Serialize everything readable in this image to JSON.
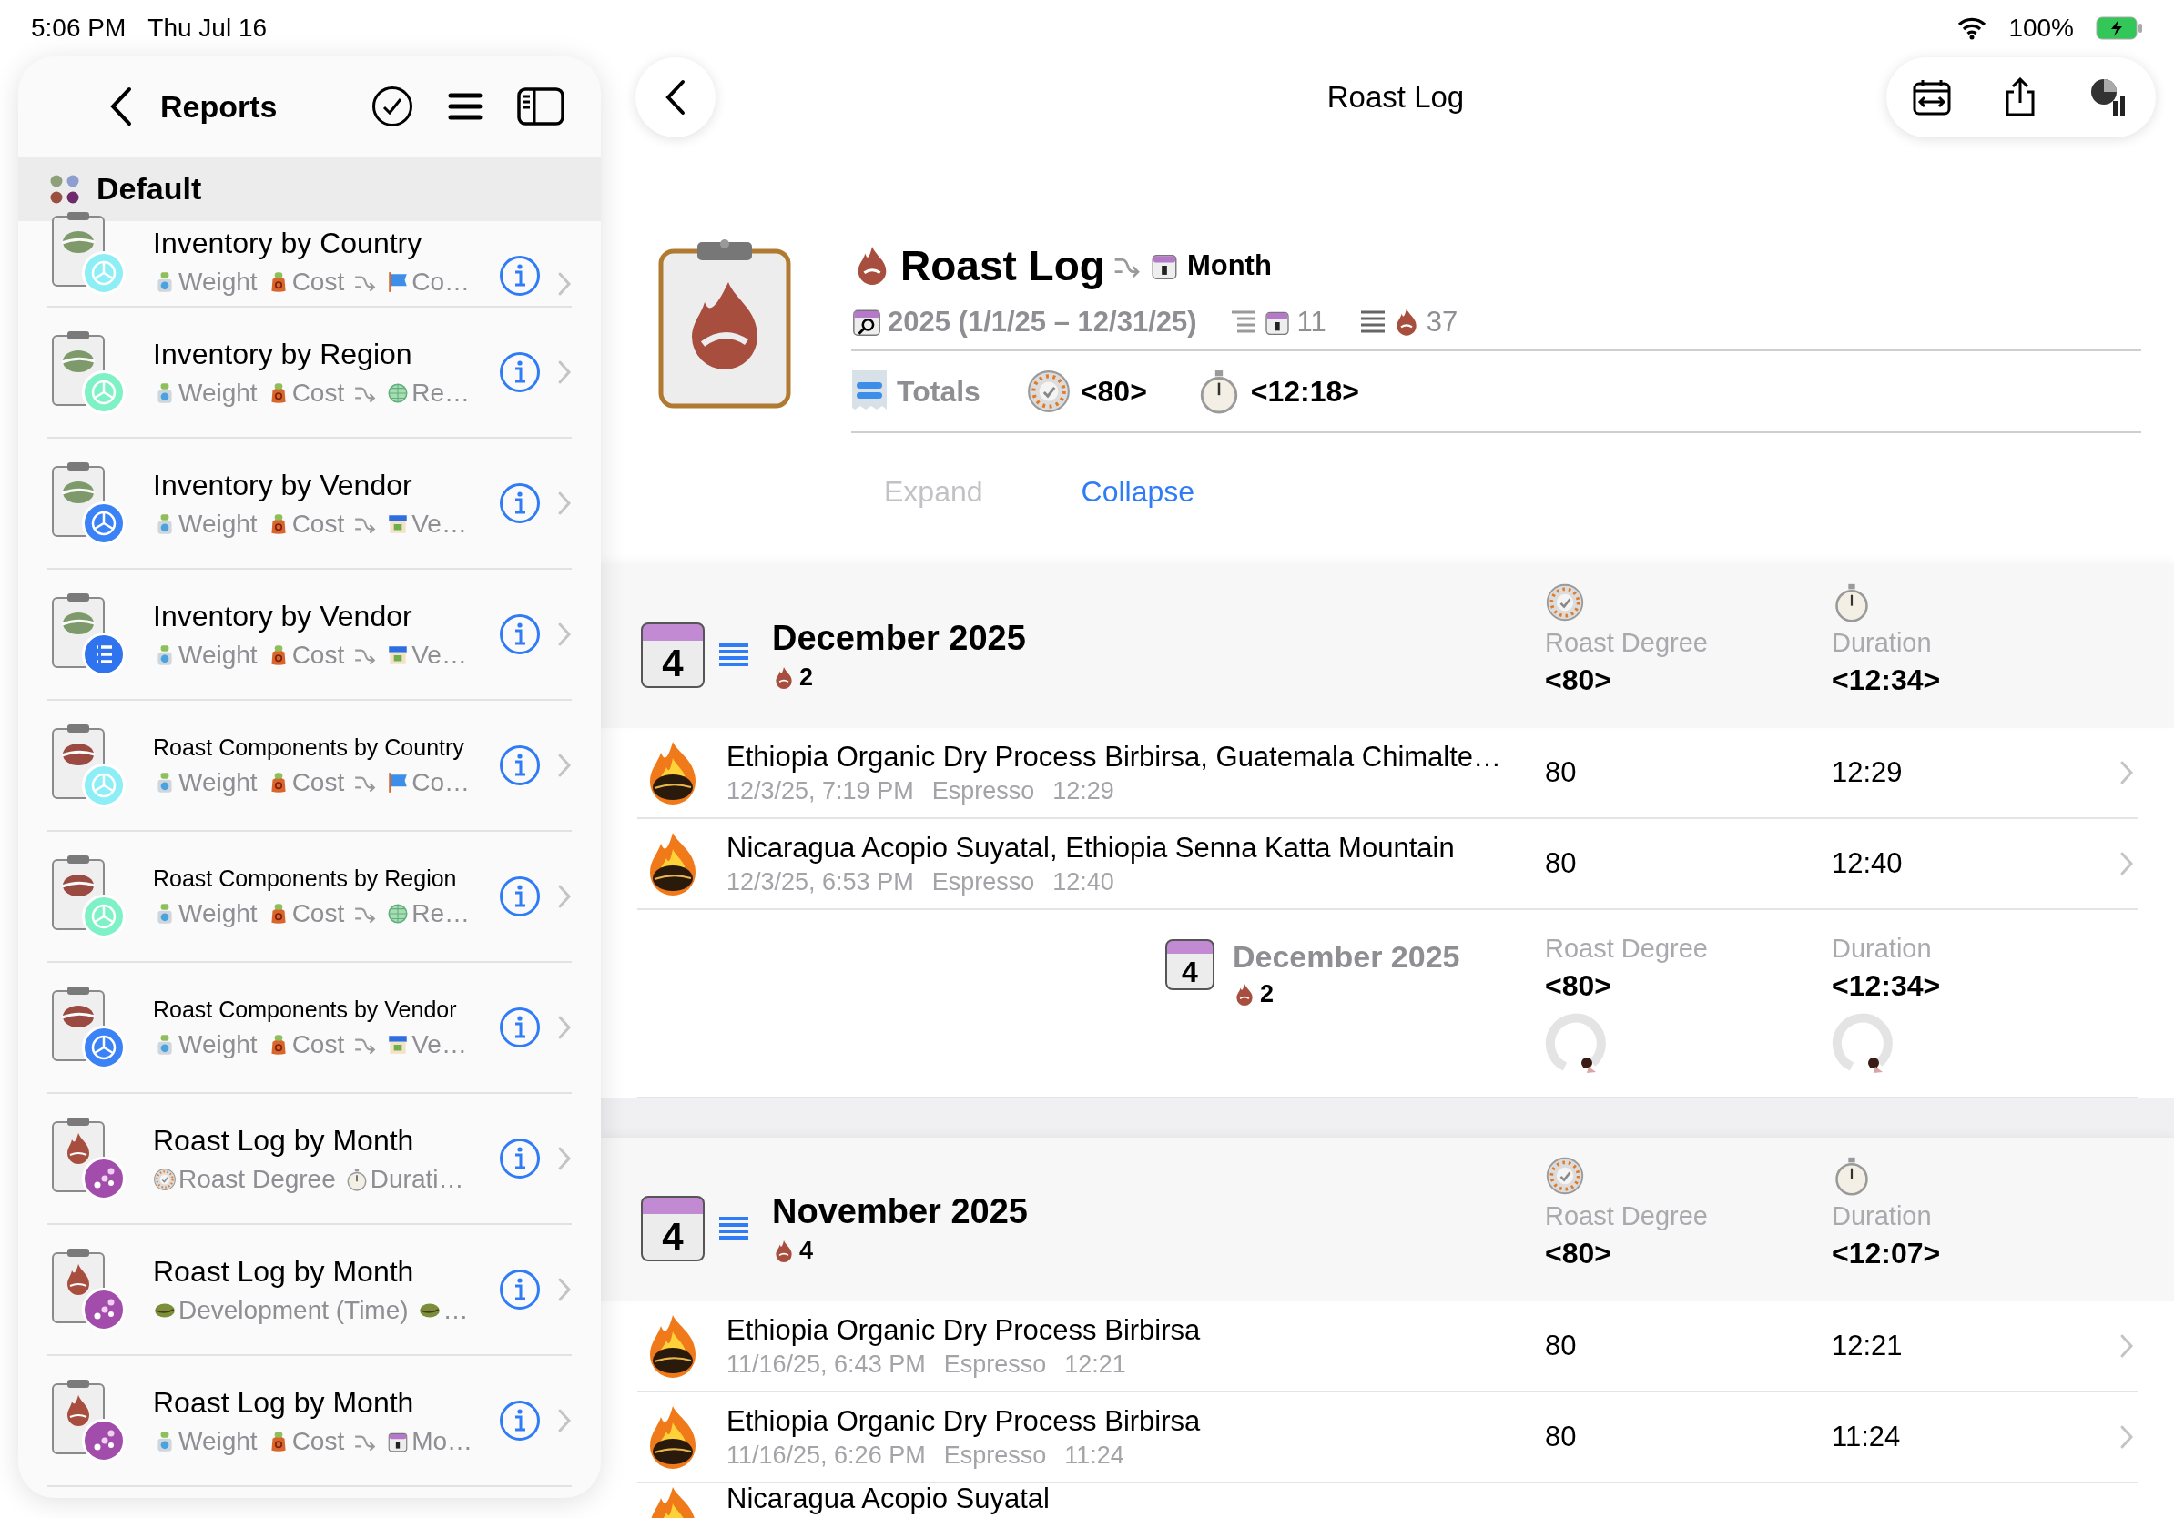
{
  "status_bar": {
    "time": "5:06 PM",
    "date": "Thu Jul 16",
    "battery": "100%"
  },
  "sidebar": {
    "title": "Reports",
    "group": "Default",
    "items": [
      {
        "title": "Inventory by Country",
        "kind": "inventory",
        "badge": {
          "kind": "pie",
          "color": "#8eeef6"
        },
        "details": [
          {
            "kind": "scale",
            "text": "Weight"
          },
          {
            "kind": "sack",
            "text": "Cost"
          },
          {
            "kind": "arrow"
          },
          {
            "kind": "flag",
            "text": "Co…"
          }
        ]
      },
      {
        "title": "Inventory by Region",
        "kind": "inventory",
        "badge": {
          "kind": "pie",
          "color": "#7ef2c6"
        },
        "details": [
          {
            "kind": "scale",
            "text": "Weight"
          },
          {
            "kind": "sack",
            "text": "Cost"
          },
          {
            "kind": "arrow"
          },
          {
            "kind": "globe",
            "text": "Re…"
          }
        ]
      },
      {
        "title": "Inventory by Vendor",
        "kind": "inventory",
        "badge": {
          "kind": "pie",
          "color": "#3b82f6"
        },
        "details": [
          {
            "kind": "scale",
            "text": "Weight"
          },
          {
            "kind": "sack",
            "text": "Cost"
          },
          {
            "kind": "arrow"
          },
          {
            "kind": "shop",
            "text": "Ve…"
          }
        ]
      },
      {
        "title": "Inventory by Vendor",
        "kind": "inventory",
        "badge": {
          "kind": "list",
          "color": "#2f74ee"
        },
        "details": [
          {
            "kind": "scale",
            "text": "Weight"
          },
          {
            "kind": "sack",
            "text": "Cost"
          },
          {
            "kind": "arrow"
          },
          {
            "kind": "shop",
            "text": "Ve…"
          }
        ]
      },
      {
        "title": "Roast Components by Country",
        "kind": "components",
        "badge": {
          "kind": "pie",
          "color": "#8eeef6"
        },
        "details": [
          {
            "kind": "scale",
            "text": "Weight"
          },
          {
            "kind": "sack",
            "text": "Cost"
          },
          {
            "kind": "arrow"
          },
          {
            "kind": "flag",
            "text": "Co…"
          }
        ]
      },
      {
        "title": "Roast Components by Region",
        "kind": "components",
        "badge": {
          "kind": "pie",
          "color": "#7ef2c6"
        },
        "details": [
          {
            "kind": "scale",
            "text": "Weight"
          },
          {
            "kind": "sack",
            "text": "Cost"
          },
          {
            "kind": "arrow"
          },
          {
            "kind": "globe",
            "text": "Re…"
          }
        ]
      },
      {
        "title": "Roast Components by Vendor",
        "kind": "components",
        "badge": {
          "kind": "pie",
          "color": "#3b82f6"
        },
        "details": [
          {
            "kind": "scale",
            "text": "Weight"
          },
          {
            "kind": "sack",
            "text": "Cost"
          },
          {
            "kind": "arrow"
          },
          {
            "kind": "shop",
            "text": "Ve…"
          }
        ]
      },
      {
        "title": "Roast Log by Month",
        "kind": "roast",
        "badge": {
          "kind": "dots",
          "color": "#a24dab"
        },
        "details": [
          {
            "kind": "gauge",
            "text": "Roast Degree"
          },
          {
            "kind": "stopwatch",
            "text": "Durati…"
          }
        ]
      },
      {
        "title": "Roast Log by Month",
        "kind": "roast",
        "badge": {
          "kind": "dots",
          "color": "#a24dab"
        },
        "details": [
          {
            "kind": "bean",
            "text": "Development (Time)"
          },
          {
            "kind": "bean",
            "text": "…"
          }
        ]
      },
      {
        "title": "Roast Log by Month",
        "kind": "roast",
        "badge": {
          "kind": "dots",
          "color": "#a24dab"
        },
        "details": [
          {
            "kind": "scale",
            "text": "Weight"
          },
          {
            "kind": "sack",
            "text": "Cost"
          },
          {
            "kind": "arrow"
          },
          {
            "kind": "calendar",
            "text": "Mo…"
          }
        ]
      }
    ]
  },
  "nav": {
    "title": "Roast Log"
  },
  "report": {
    "title": "Roast Log",
    "group_by": "Month",
    "range": "2025 (1/1/25 – 12/31/25)",
    "month_count": "11",
    "roast_count": "37",
    "totals_label": "Totals",
    "totals": [
      {
        "kind": "gauge",
        "value": "<80>"
      },
      {
        "kind": "stopwatch",
        "value": "<12:18>"
      }
    ],
    "actions": [
      {
        "label": "Expand",
        "disabled": true
      },
      {
        "label": "Collapse",
        "disabled": false
      }
    ]
  },
  "sections": [
    {
      "day": "4",
      "title": "December 2025",
      "count": "2",
      "columns": [
        {
          "kind": "gauge",
          "label": "Roast Degree",
          "value": "<80>"
        },
        {
          "kind": "stopwatch",
          "label": "Duration",
          "value": "<12:34>"
        }
      ],
      "rows": [
        {
          "title": "Ethiopia Organic Dry Process Birbirsa, Guatemala Chimalte…",
          "date": "12/3/25, 7:19 PM",
          "method": "Espresso",
          "time": "12:29",
          "degree": "80",
          "duration": "12:29"
        },
        {
          "title": "Nicaragua Acopio Suyatal, Ethiopia Senna Katta Mountain",
          "date": "12/3/25, 6:53 PM",
          "method": "Espresso",
          "time": "12:40",
          "degree": "80",
          "duration": "12:40"
        }
      ],
      "footer": {
        "day": "4",
        "title": "December 2025",
        "count": "2",
        "columns": [
          {
            "label": "Roast Degree",
            "value": "<80>"
          },
          {
            "label": "Duration",
            "value": "<12:34>"
          }
        ]
      }
    },
    {
      "day": "4",
      "title": "November 2025",
      "count": "4",
      "columns": [
        {
          "kind": "gauge",
          "label": "Roast Degree",
          "value": "<80>"
        },
        {
          "kind": "stopwatch",
          "label": "Duration",
          "value": "<12:07>"
        }
      ],
      "rows": [
        {
          "title": "Ethiopia Organic Dry Process Birbirsa",
          "date": "11/16/25, 6:43 PM",
          "method": "Espresso",
          "time": "12:21",
          "degree": "80",
          "duration": "12:21"
        },
        {
          "title": "Ethiopia Organic Dry Process Birbirsa",
          "date": "11/16/25, 6:26 PM",
          "method": "Espresso",
          "time": "11:24",
          "degree": "80",
          "duration": "11:24"
        },
        {
          "title": "Nicaragua Acopio Suyatal"
        }
      ]
    }
  ]
}
